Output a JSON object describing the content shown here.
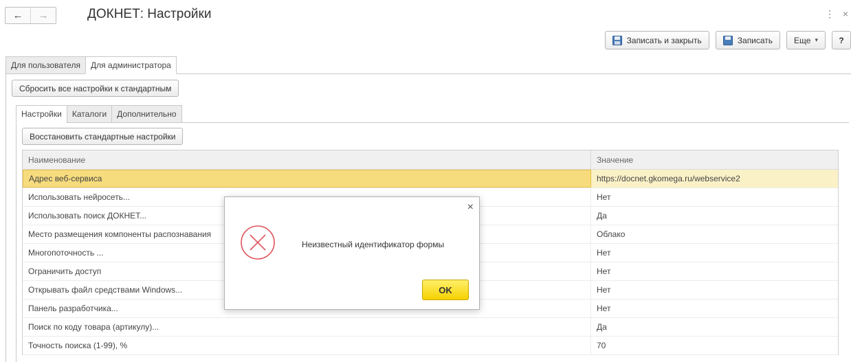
{
  "window": {
    "title": "ДОКНЕТ: Настройки",
    "back_icon": "←",
    "forward_icon": "→",
    "menu_icon": "⋮",
    "close_icon": "×"
  },
  "toolbar": {
    "save_close_label": "Записать и закрыть",
    "save_label": "Записать",
    "more_label": "Еще",
    "more_caret": "▾",
    "help_label": "?"
  },
  "tabs": {
    "user": "Для пользователя",
    "admin": "Для администратора"
  },
  "reset_all_label": "Сбросить все настройки к стандартным",
  "subtabs": {
    "settings": "Настройки",
    "catalogs": "Каталоги",
    "extra": "Дополнительно"
  },
  "restore_label": "Восстановить стандартные настройки",
  "table": {
    "col_name": "Наименование",
    "col_value": "Значение",
    "rows": [
      {
        "name": "Адрес веб-сервиса",
        "value": "https://docnet.gkomega.ru/webservice2"
      },
      {
        "name": "Использовать нейросеть...",
        "value": "Нет"
      },
      {
        "name": "Использовать поиск ДОКНЕТ...",
        "value": "Да"
      },
      {
        "name": "Место размещения компоненты распознавания",
        "value": "Облако"
      },
      {
        "name": "Многопоточность ...",
        "value": "Нет"
      },
      {
        "name": "Ограничить доступ",
        "value": "Нет"
      },
      {
        "name": "Открывать файл средствами Windows...",
        "value": "Нет"
      },
      {
        "name": "Панель разработчика...",
        "value": "Нет"
      },
      {
        "name": "Поиск по коду товара (артикулу)...",
        "value": "Да"
      },
      {
        "name": "Точность поиска (1-99), %",
        "value": "70"
      }
    ]
  },
  "dialog": {
    "message": "Неизвестный идентификатор формы",
    "ok_label": "OK",
    "close_icon": "×",
    "icon": "error-icon"
  },
  "colors": {
    "selected_row": "#f7dc7e",
    "ok_button": "#f5d100",
    "error_icon": "#e0525a"
  }
}
